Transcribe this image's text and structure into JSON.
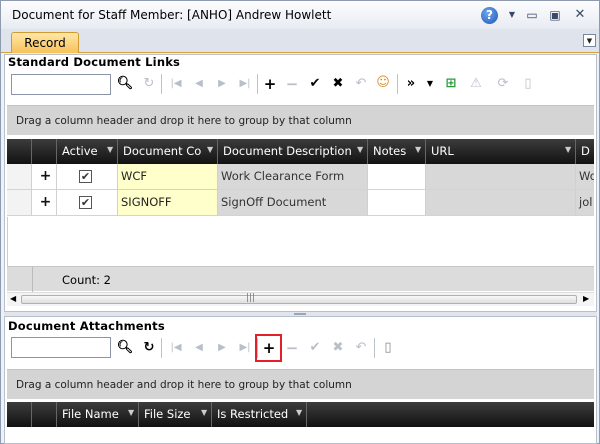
{
  "window": {
    "title": "Document for Staff Member: [ANHO] Andrew Howlett"
  },
  "tabs": [
    {
      "label": "Record"
    }
  ],
  "links": {
    "section_title": "Standard Document Links",
    "search_placeholder": "",
    "group_hint": "Drag a column header and drop it here to group by that column",
    "columns": [
      "Active",
      "Document Co",
      "Document Description",
      "Notes",
      "URL",
      "D"
    ],
    "rows": [
      {
        "active": "✔",
        "code": "WCF",
        "description": "Work Clearance Form",
        "notes": "",
        "url": "",
        "extra": "Wo"
      },
      {
        "active": "✔",
        "code": "SIGNOFF",
        "description": "SignOff Document",
        "notes": "",
        "url": "",
        "extra": "jol"
      }
    ],
    "count_label": "Count: 2"
  },
  "attachments": {
    "section_title": "Document Attachments",
    "search_placeholder": "",
    "group_hint": "Drag a column header and drop it here to group by that column",
    "columns": [
      "File Name",
      "File Size",
      "Is Restricted"
    ]
  },
  "colors": {
    "accent_tab": "#f7c25a",
    "highlight_box": "#e3202a",
    "code_cell": "#ffffcc"
  }
}
